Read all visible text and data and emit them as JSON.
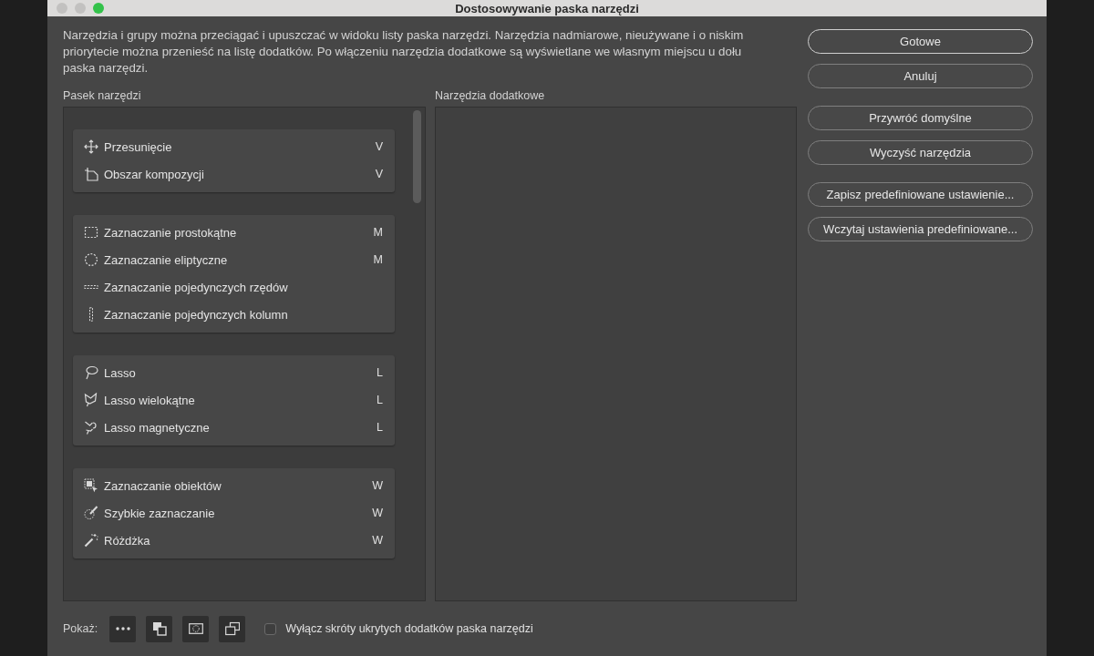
{
  "window": {
    "title": "Dostosowywanie paska narzędzi"
  },
  "description": "Narzędzia i grupy można przeciągać i upuszczać w widoku listy paska narzędzi. Narzędzia nadmiarowe, nieużywane i o niskim priorytecie można przenieść na listę dodatków. Po włączeniu narzędzia dodatkowe są wyświetlane we własnym miejscu u dołu paska narzędzi.",
  "toolbar_list": {
    "label": "Pasek narzędzi",
    "groups": [
      {
        "tools": [
          {
            "name": "Przesunięcie",
            "shortcut": "V"
          },
          {
            "name": "Obszar kompozycji",
            "shortcut": "V"
          }
        ]
      },
      {
        "tools": [
          {
            "name": "Zaznaczanie prostokątne",
            "shortcut": "M"
          },
          {
            "name": "Zaznaczanie eliptyczne",
            "shortcut": "M"
          },
          {
            "name": "Zaznaczanie pojedynczych rzędów"
          },
          {
            "name": "Zaznaczanie pojedynczych kolumn"
          }
        ]
      },
      {
        "tools": [
          {
            "name": "Lasso",
            "shortcut": "L"
          },
          {
            "name": "Lasso wielokątne",
            "shortcut": "L"
          },
          {
            "name": "Lasso magnetyczne",
            "shortcut": "L"
          }
        ]
      },
      {
        "tools": [
          {
            "name": "Zaznaczanie obiektów",
            "shortcut": "W"
          },
          {
            "name": "Szybkie zaznaczanie",
            "shortcut": "W"
          },
          {
            "name": "Różdżka",
            "shortcut": "W"
          }
        ]
      }
    ]
  },
  "extra_tools": {
    "label": "Narzędzia dodatkowe"
  },
  "button_groups": [
    {
      "buttons": [
        {
          "label": "Gotowe",
          "default": true
        },
        {
          "label": "Anuluj",
          "default": false
        }
      ]
    },
    {
      "buttons": [
        {
          "label": "Przywróć domyślne",
          "default": false
        },
        {
          "label": "Wyczyść narzędzia",
          "default": false
        }
      ]
    },
    {
      "buttons": [
        {
          "label": "Zapisz predefiniowane ustawienie...",
          "default": false
        },
        {
          "label": "Wczytaj ustawienia predefiniowane...",
          "default": false
        }
      ]
    }
  ],
  "footer": {
    "show_label": "Pokaż:",
    "checkbox": {
      "label": "Wyłącz skróty ukrytych dodatków paska narzędzi",
      "checked": false
    }
  }
}
